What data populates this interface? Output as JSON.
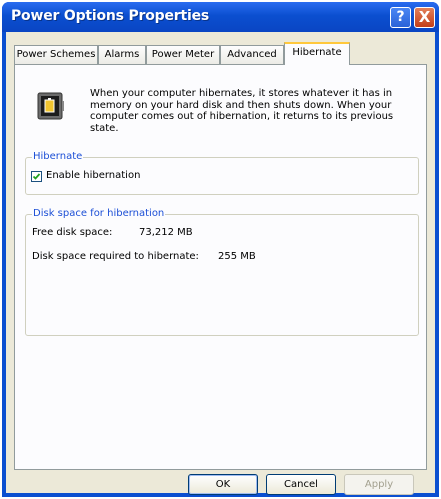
{
  "window": {
    "title": "Power Options Properties",
    "help_glyph": "?",
    "close_glyph": "X"
  },
  "tabs": [
    {
      "label": "Power Schemes"
    },
    {
      "label": "Alarms"
    },
    {
      "label": "Power Meter"
    },
    {
      "label": "Advanced"
    },
    {
      "label": "Hibernate",
      "active": true
    }
  ],
  "hibernate": {
    "description": "When your computer hibernates, it stores whatever it has in memory on your hard disk and then shuts down. When your computer comes out of hibernation, it returns to its previous state.",
    "group_title": "Hibernate",
    "enable_label": "Enable hibernation",
    "enable_checked": true
  },
  "disk_space": {
    "group_title": "Disk space for hibernation",
    "free_label": "Free disk space:",
    "free_value": "73,212 MB",
    "required_label": "Disk space required to hibernate:",
    "required_value": "255 MB"
  },
  "buttons": {
    "ok": "OK",
    "cancel": "Cancel",
    "apply": "Apply"
  },
  "colors": {
    "titlebar": "#0b4fd0",
    "group_title": "#1c4fd6",
    "active_tab_accent": "#ffc83c"
  },
  "icons": {
    "battery": "battery-monitor-icon",
    "check": "check-icon"
  }
}
